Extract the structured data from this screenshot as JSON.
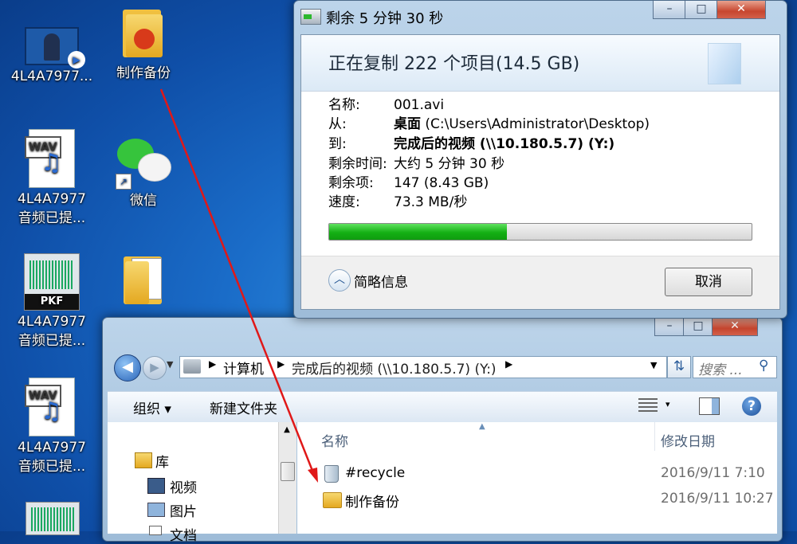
{
  "desktop": {
    "icons": [
      {
        "name": "desktop-icon-video",
        "label": "4L4A7977...",
        "kind": "video"
      },
      {
        "name": "desktop-icon-folder-backup",
        "label": "制作备份",
        "kind": "folder"
      },
      {
        "name": "desktop-icon-wav-1",
        "label_line1": "4L4A7977",
        "label_line2": "音频已提...",
        "kind": "wav",
        "tag": "WAV"
      },
      {
        "name": "desktop-icon-wechat",
        "label": "微信",
        "kind": "wechat"
      },
      {
        "name": "desktop-icon-pkf",
        "label_line1": "4L4A7977",
        "label_line2": "音频已提...",
        "kind": "pkf",
        "tag": "PKF"
      },
      {
        "name": "desktop-icon-wav-2",
        "label_line1": "4L4A7977",
        "label_line2": "音频已提...",
        "kind": "wav",
        "tag": "WAV"
      }
    ]
  },
  "copy_dialog": {
    "title": "剩余 5 分钟 30 秒",
    "heading": "正在复制 222 个项目(14.5 GB)",
    "rows": {
      "name_label": "名称:",
      "name_value": "001.avi",
      "from_label": "从:",
      "from_bold": "桌面",
      "from_rest": " (C:\\Users\\Administrator\\Desktop)",
      "to_label": "到:",
      "to_value": "完成后的视频 (\\\\10.180.5.7) (Y:)",
      "time_label": "剩余时间:",
      "time_value": "大约 5 分钟 30 秒",
      "items_label": "剩余项:",
      "items_value": "147 (8.43 GB)",
      "speed_label": "速度:",
      "speed_value": "73.3 MB/秒"
    },
    "progress": 0.42,
    "details_toggle": "简略信息",
    "cancel": "取消",
    "caption_buttons": {
      "minimize": "–",
      "maximize": "□",
      "close": "✕"
    }
  },
  "explorer": {
    "breadcrumb": [
      "计算机",
      "完成后的视频 (\\\\10.180.5.7) (Y:)"
    ],
    "search_placeholder": "搜索 ...",
    "toolbar": {
      "organize": "组织 ▾",
      "new_folder": "新建文件夹",
      "view": "▾"
    },
    "nav": [
      {
        "label": "库",
        "icon": "library-icon"
      },
      {
        "label": "视频",
        "icon": "video-library-icon"
      },
      {
        "label": "图片",
        "icon": "picture-library-icon"
      },
      {
        "label": "文档",
        "icon": "document-library-icon"
      }
    ],
    "columns": {
      "name": "名称",
      "modified": "修改日期"
    },
    "files": [
      {
        "name": "#recycle",
        "date": "2016/9/11 7:10",
        "icon": "recycle-bin-icon"
      },
      {
        "name": "制作备份",
        "date": "2016/9/11 10:27",
        "icon": "folder-icon"
      }
    ],
    "caption_buttons": {
      "minimize": "–",
      "maximize": "□",
      "close": "✕"
    }
  },
  "colors": {
    "progress_fill": "#14b014",
    "annotation_arrow": "#e01818",
    "desktop": "#1a6cc8"
  }
}
